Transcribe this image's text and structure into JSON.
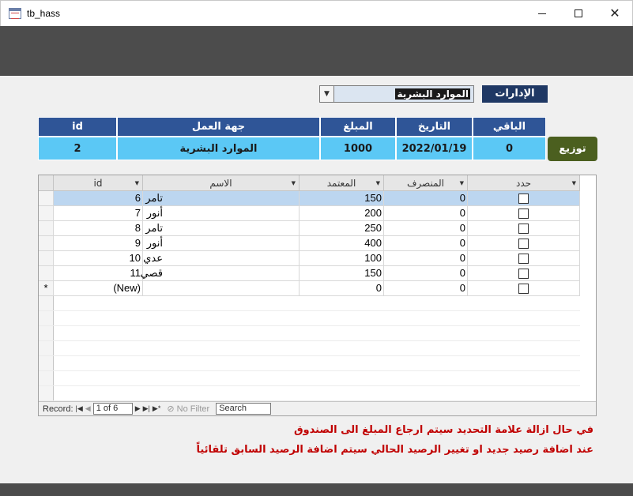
{
  "window": {
    "title": "tb_hass"
  },
  "department": {
    "label": "الإدارات",
    "value": "الموارد البشرية"
  },
  "summary": {
    "headers": {
      "remaining": "الباقي",
      "date": "التاريخ",
      "amount": "المبلغ",
      "entity": "جهة العمل",
      "id": "id"
    },
    "values": {
      "remaining": "0",
      "date": "2022/01/19",
      "amount": "1000",
      "entity": "الموارد البشرية",
      "id": "2"
    },
    "distribute_label": "توزيع"
  },
  "datasheet": {
    "columns": {
      "select": "حدد",
      "spent": "المنصرف",
      "approved": "المعتمد",
      "name": "الاسم",
      "id": "id"
    },
    "rows": [
      {
        "id": "6",
        "name": "تامر",
        "approved": "150",
        "spent": "0",
        "checked": false
      },
      {
        "id": "7",
        "name": "أنور",
        "approved": "200",
        "spent": "0",
        "checked": false
      },
      {
        "id": "8",
        "name": "تامر",
        "approved": "250",
        "spent": "0",
        "checked": false
      },
      {
        "id": "9",
        "name": "أنور",
        "approved": "400",
        "spent": "0",
        "checked": false
      },
      {
        "id": "10",
        "name": "عدي",
        "approved": "100",
        "spent": "0",
        "checked": false
      },
      {
        "id": "11",
        "name": "قصي",
        "approved": "150",
        "spent": "0",
        "checked": false
      }
    ],
    "new_row": {
      "marker": "*",
      "id": "(New)",
      "approved": "0",
      "spent": "0"
    },
    "navigation": {
      "record_label": "Record:",
      "record_position": "1 of 6",
      "filter_label": "No Filter",
      "search_placeholder": "Search"
    }
  },
  "notes": {
    "line1": "في حال ازالة علامة التحديد سيتم ارجاع المبلغ الى الصندوق",
    "line2": "عند اضافة رصيد جديد او تغيير الرصيد الحالي سيتم اضافة الرصيد السابق تلقائياً"
  },
  "colors": {
    "header_band": "#4c4c4c",
    "summary_header": "#2f5597",
    "summary_value": "#5bc8f5",
    "distribute_button": "#4b5f1f",
    "note_text": "#c00000"
  }
}
